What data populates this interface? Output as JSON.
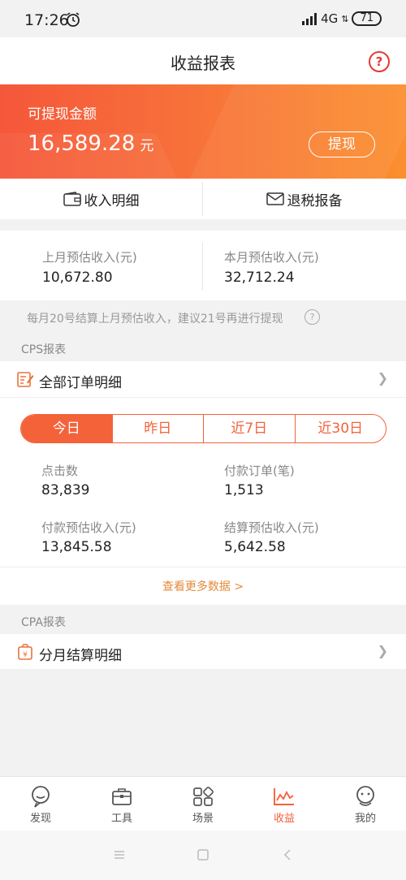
{
  "status_bar": {
    "time": "17:26",
    "network": "4G",
    "battery": "71"
  },
  "header": {
    "title": "收益报表",
    "help_label": "?"
  },
  "balance": {
    "label": "可提现金额",
    "amount": "16,589.28",
    "unit": "元",
    "withdraw_label": "提现"
  },
  "shortcuts": {
    "income_detail": "收入明细",
    "tax_filing": "退税报备"
  },
  "estimates": {
    "last_month_label": "上月预估收入(元)",
    "last_month_value": "10,672.80",
    "this_month_label": "本月预估收入(元)",
    "this_month_value": "32,712.24"
  },
  "notice": {
    "text": "每月20号结算上月预估收入，建议21号再进行提现",
    "help": "?"
  },
  "cps": {
    "section_title": "CPS报表",
    "orders_label": "全部订单明细",
    "tabs": [
      "今日",
      "昨日",
      "近7日",
      "近30日"
    ],
    "metrics": [
      {
        "label": "点击数",
        "value": "83,839"
      },
      {
        "label": "付款订单(笔)",
        "value": "1,513"
      },
      {
        "label": "付款预估收入(元)",
        "value": "13,845.58"
      },
      {
        "label": "结算预估收入(元)",
        "value": "5,642.58"
      }
    ],
    "more_label": "查看更多数据 >"
  },
  "cpa": {
    "section_title": "CPA报表",
    "monthly_label": "分月结算明细"
  },
  "nav": [
    {
      "label": "发现",
      "icon": "discover-icon"
    },
    {
      "label": "工具",
      "icon": "toolbox-icon"
    },
    {
      "label": "场景",
      "icon": "grid-icon"
    },
    {
      "label": "收益",
      "icon": "chart-icon"
    },
    {
      "label": "我的",
      "icon": "profile-icon"
    }
  ],
  "colors": {
    "accent": "#f4623a",
    "banner_start": "#f5573a",
    "banner_end": "#fb8f2e"
  }
}
